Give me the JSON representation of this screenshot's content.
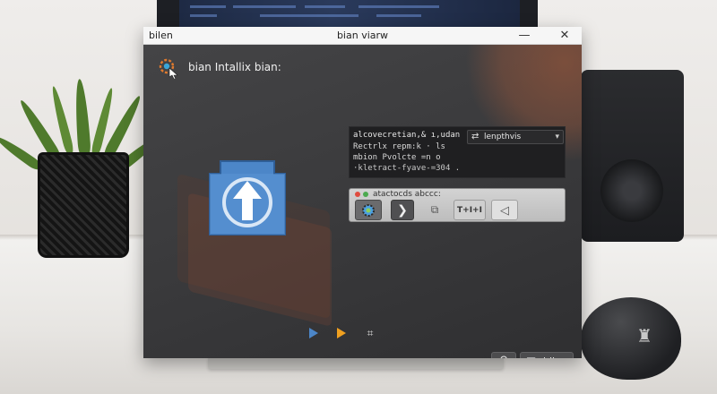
{
  "window": {
    "app_name": "bilen",
    "title": "bian viarw",
    "minimize_icon": "minimize-icon",
    "close_icon": "close-icon"
  },
  "header": {
    "icon": "gear-cursor-icon",
    "title": "bian Intallix bian:"
  },
  "main_icon": "upload-arrow-icon",
  "info_panel": {
    "line1": "alcovecretian,& ı,udan",
    "line2": "Rectrlx repm:k · ls",
    "line3": "mbion Pvolcte =n o",
    "line4": "·kletract-fyave-=304 ."
  },
  "dropdown": {
    "icon": "shuffle-icon",
    "label": "lenpthvis"
  },
  "toolbar": {
    "title": "atactocds abccc:",
    "buttons": [
      {
        "icon": "gear-icon"
      },
      {
        "icon": "chevron-right-icon"
      },
      {
        "icon": "copy-icon"
      },
      {
        "label": "T+I+I"
      },
      {
        "icon": "collapse-icon"
      }
    ]
  },
  "playback": {
    "controls": [
      "play-icon",
      "forward-icon",
      "frame-icon"
    ]
  },
  "bottom_bar": {
    "link_icon": "link-icon",
    "action_icon": "image-icon",
    "action_label": "biian"
  },
  "colors": {
    "window_bg": "#3b3b3d",
    "accent_blue": "#4c86c8",
    "accent_orange": "#f0a020",
    "accent_warm": "#ad5c3a"
  }
}
